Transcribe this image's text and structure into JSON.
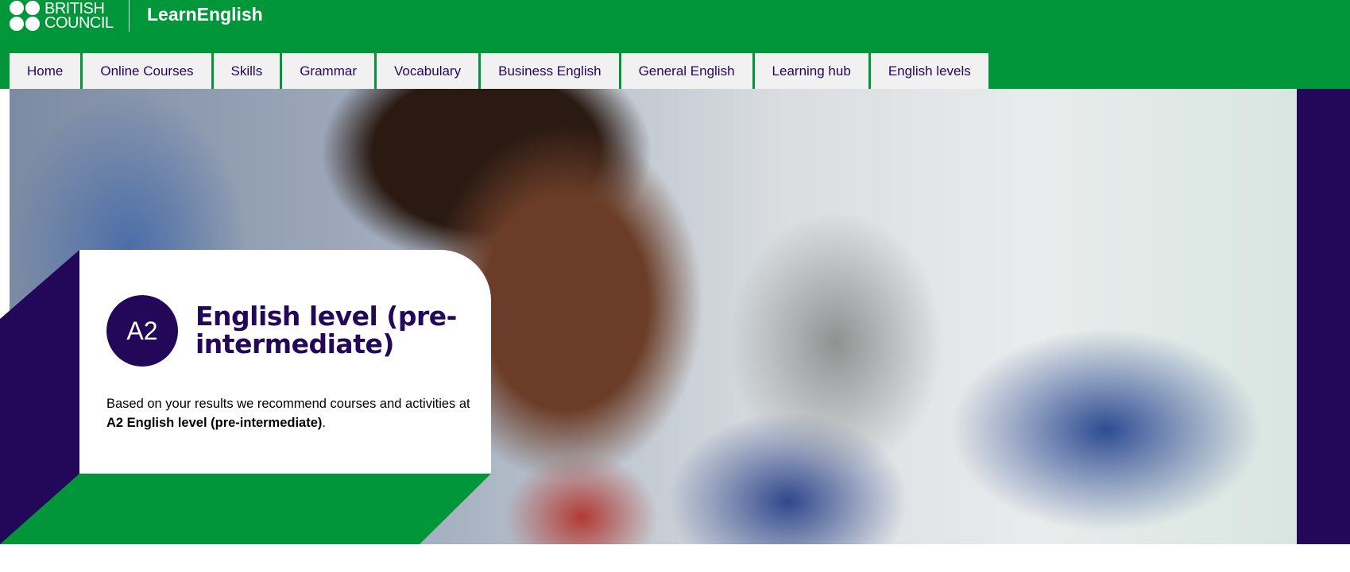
{
  "header": {
    "logo_line1": "BRITISH",
    "logo_line2": "COUNCIL",
    "site_name": "LearnEnglish",
    "background_color": "#009639"
  },
  "nav": {
    "tabs": [
      {
        "label": "Home"
      },
      {
        "label": "Online Courses"
      },
      {
        "label": "Skills"
      },
      {
        "label": "Grammar"
      },
      {
        "label": "Vocabulary"
      },
      {
        "label": "Business English"
      },
      {
        "label": "General English"
      },
      {
        "label": "Learning hub"
      },
      {
        "label": "English levels"
      }
    ]
  },
  "hero": {
    "accent_purple": "#23085a",
    "accent_green": "#009639"
  },
  "card": {
    "badge": "A2",
    "title": "English level (pre-intermediate)",
    "desc_before": "Based on your results we recommend courses and activities at ",
    "desc_bold": "A2 English level (pre-intermediate)",
    "desc_after": "."
  }
}
